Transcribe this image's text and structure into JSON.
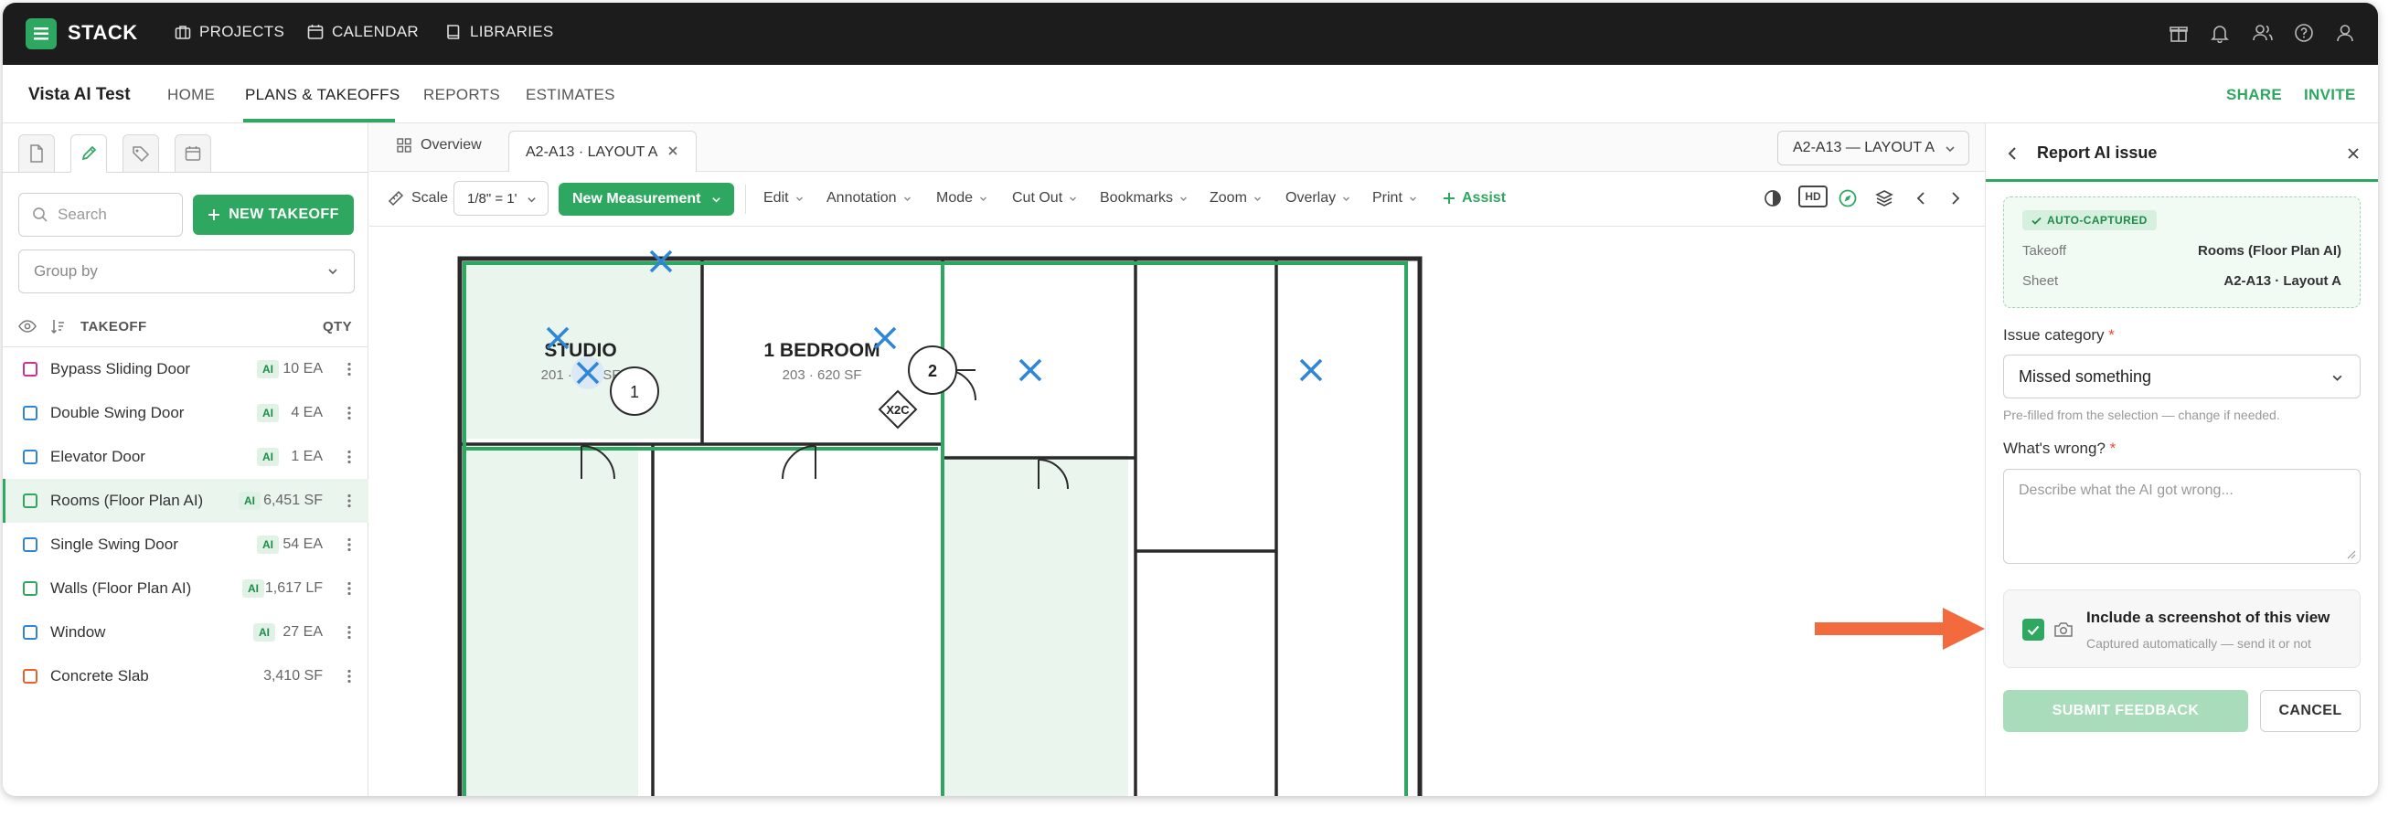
{
  "app": {
    "brand": "STACK",
    "nav": [
      "PROJECTS",
      "CALENDAR",
      "LIBRARIES"
    ],
    "icons": [
      "gift-icon",
      "bell-icon",
      "users-icon",
      "help-icon",
      "user-icon"
    ]
  },
  "subnav": {
    "project": "Vista AI Test",
    "tabs": [
      "HOME",
      "PLANS & TAKEOFFS",
      "REPORTS",
      "ESTIMATES"
    ],
    "active_tab": "PLANS & TAKEOFFS",
    "share": "SHARE",
    "invite": "INVITE"
  },
  "left": {
    "search_placeholder": "Search",
    "new_takeoff": "NEW TAKEOFF",
    "group_by": "Group by",
    "col_takeoff": "TAKEOFF",
    "col_qty": "QTY",
    "items": [
      {
        "name": "Bypass Sliding Door",
        "ai": "AI",
        "qty": "10 EA",
        "color": "#c8348f"
      },
      {
        "name": "Double Swing Door",
        "ai": "AI",
        "qty": "4 EA",
        "color": "#2f86d6"
      },
      {
        "name": "Elevator Door",
        "ai": "AI",
        "qty": "1 EA",
        "color": "#2f86d6"
      },
      {
        "name": "Rooms (Floor Plan AI)",
        "ai": "AI",
        "qty": "6,451 SF",
        "color": "#2ea860",
        "selected": true
      },
      {
        "name": "Single Swing Door",
        "ai": "AI",
        "qty": "54 EA",
        "color": "#2f86d6"
      },
      {
        "name": "Walls (Floor Plan AI)",
        "ai": "AI",
        "qty": "1,617 LF",
        "color": "#2ea860"
      },
      {
        "name": "Window",
        "ai": "AI",
        "qty": "27 EA",
        "color": "#2f86d6"
      },
      {
        "name": "Concrete Slab",
        "ai": "",
        "qty": "3,410 SF",
        "color": "#e8622c"
      }
    ]
  },
  "doc": {
    "overview": "Overview",
    "tab": "A2-A13 · LAYOUT A",
    "sheet_select": "A2-A13 — LAYOUT A"
  },
  "toolbar": {
    "scale_label": "Scale",
    "scale_value": "1/8\" = 1'",
    "new_measurement": "New Measurement",
    "menus": [
      "Edit",
      "Annotation",
      "Mode",
      "Cut Out",
      "Bookmarks",
      "Zoom",
      "Overlay",
      "Print"
    ],
    "assist": "Assist",
    "hd": "HD"
  },
  "plan": {
    "rooms": [
      {
        "name": "STUDIO",
        "sub": "201 · 410 SF",
        "tag": "1"
      },
      {
        "name": "1 BEDROOM",
        "sub": "203 · 620 SF",
        "tag": "X2C"
      }
    ],
    "tag2": "2"
  },
  "panel": {
    "title": "Report AI issue",
    "badge": "AUTO-CAPTURED",
    "takeoff_label": "Takeoff",
    "takeoff_value": "Rooms (Floor Plan AI)",
    "sheet_label": "Sheet",
    "sheet_value": "A2-A13 · Layout A",
    "category_label": "Issue category",
    "category_value": "Missed something",
    "category_hint": "Pre-filled from the selection — change if needed.",
    "wrong_label": "What's wrong?",
    "wrong_placeholder": "Describe what the AI got wrong...",
    "required_mark": "*",
    "screenshot_title": "Include a screenshot of this view",
    "screenshot_sub": "Captured automatically — send it or not",
    "screenshot_checked": true,
    "submit": "SUBMIT FEEDBACK",
    "cancel": "CANCEL"
  },
  "colors": {
    "accent": "#2ea860",
    "topbar": "#1c1c1c",
    "arrow": "#f26a3d",
    "marker": "#2f86d6"
  }
}
